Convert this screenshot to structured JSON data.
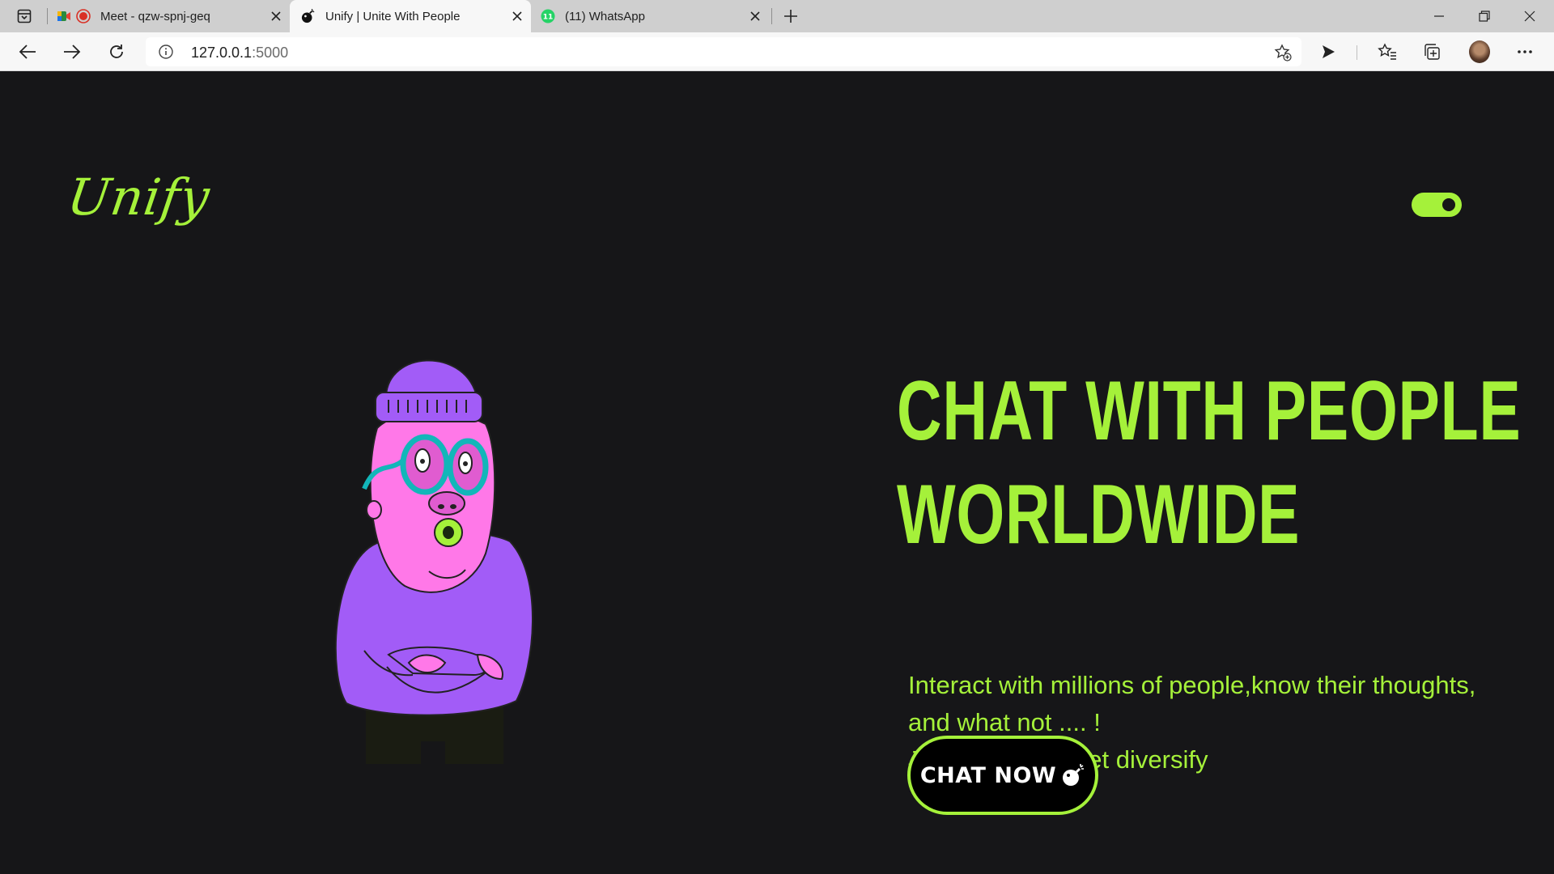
{
  "browser": {
    "tabs": [
      {
        "title": "Meet - qzw-spnj-geq",
        "favicon": "google-meet-icon",
        "active": false
      },
      {
        "title": "Unify | Unite With People",
        "favicon": "bomb-icon",
        "active": true
      },
      {
        "title": "(11) WhatsApp",
        "favicon": "whatsapp-icon",
        "active": false,
        "badge": "11"
      }
    ],
    "address": {
      "host": "127.0.0.1",
      "port": ":5000"
    }
  },
  "page": {
    "logo": "Unify",
    "headline": [
      "CHAT WITH PEOPLE",
      "WORLDWIDE"
    ],
    "subtitle": [
      "Interact with millions of people,know their thoughts,",
      "and what not .... !",
      "Join Unify and get diversify"
    ],
    "cta_label": "CHAT NOW",
    "theme_toggle": "on"
  },
  "colors": {
    "accent": "#a5f13a",
    "background": "#161618",
    "character_skin": "#ff78e8",
    "character_sweater": "#a25cf7",
    "glasses": "#12b6b9"
  }
}
